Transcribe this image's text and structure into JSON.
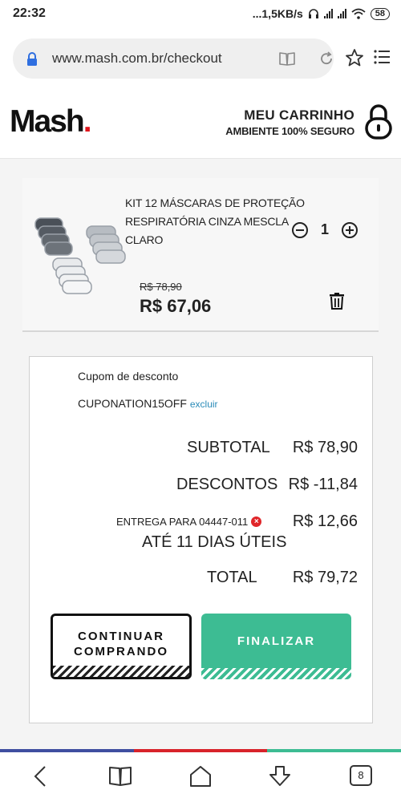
{
  "status_bar": {
    "time": "22:32",
    "network_speed": "...1,5KB/s",
    "battery": "58"
  },
  "browser": {
    "url": "www.mash.com.br/checkout",
    "tab_count": "8"
  },
  "header": {
    "logo_text": "Mash",
    "logo_dot": ".",
    "cart_title": "MEU CARRINHO",
    "cart_subtitle": "AMBIENTE 100% SEGURO"
  },
  "product": {
    "name": "KIT 12 MÁSCARAS DE PROTEÇÃO RESPIRATÓRIA CINZA MESCLA CLARO",
    "quantity": "1",
    "old_price": "R$ 78,90",
    "price": "R$ 67,06"
  },
  "coupon": {
    "label": "Cupom de desconto",
    "code": "CUPONATION15OFF",
    "remove_label": "excluir"
  },
  "summary": {
    "subtotal_label": "SUBTOTAL",
    "subtotal_value": "R$ 78,90",
    "discount_label": "DESCONTOS",
    "discount_value": "R$ -11,84",
    "shipping_label": "ENTREGA PARA 04447-011",
    "shipping_days": "ATÉ 11 DIAS ÚTEIS",
    "shipping_value": "R$ 12,66",
    "total_label": "TOTAL",
    "total_value": "R$ 79,72"
  },
  "buttons": {
    "continue_line1": "CONTINUAR",
    "continue_line2": "COMPRANDO",
    "finalize": "FINALIZAR"
  },
  "colors": {
    "accent": "#3dbc93",
    "brand_red": "#e0151c",
    "link": "#2a8bb8"
  },
  "icons": [
    "lock-icon",
    "reader-icon",
    "reload-icon",
    "star-icon",
    "menu-icon",
    "padlock-icon",
    "minus-icon",
    "plus-icon",
    "trash-icon",
    "back-icon",
    "bookmarks-icon",
    "home-icon",
    "download-icon",
    "tabs-icon"
  ]
}
